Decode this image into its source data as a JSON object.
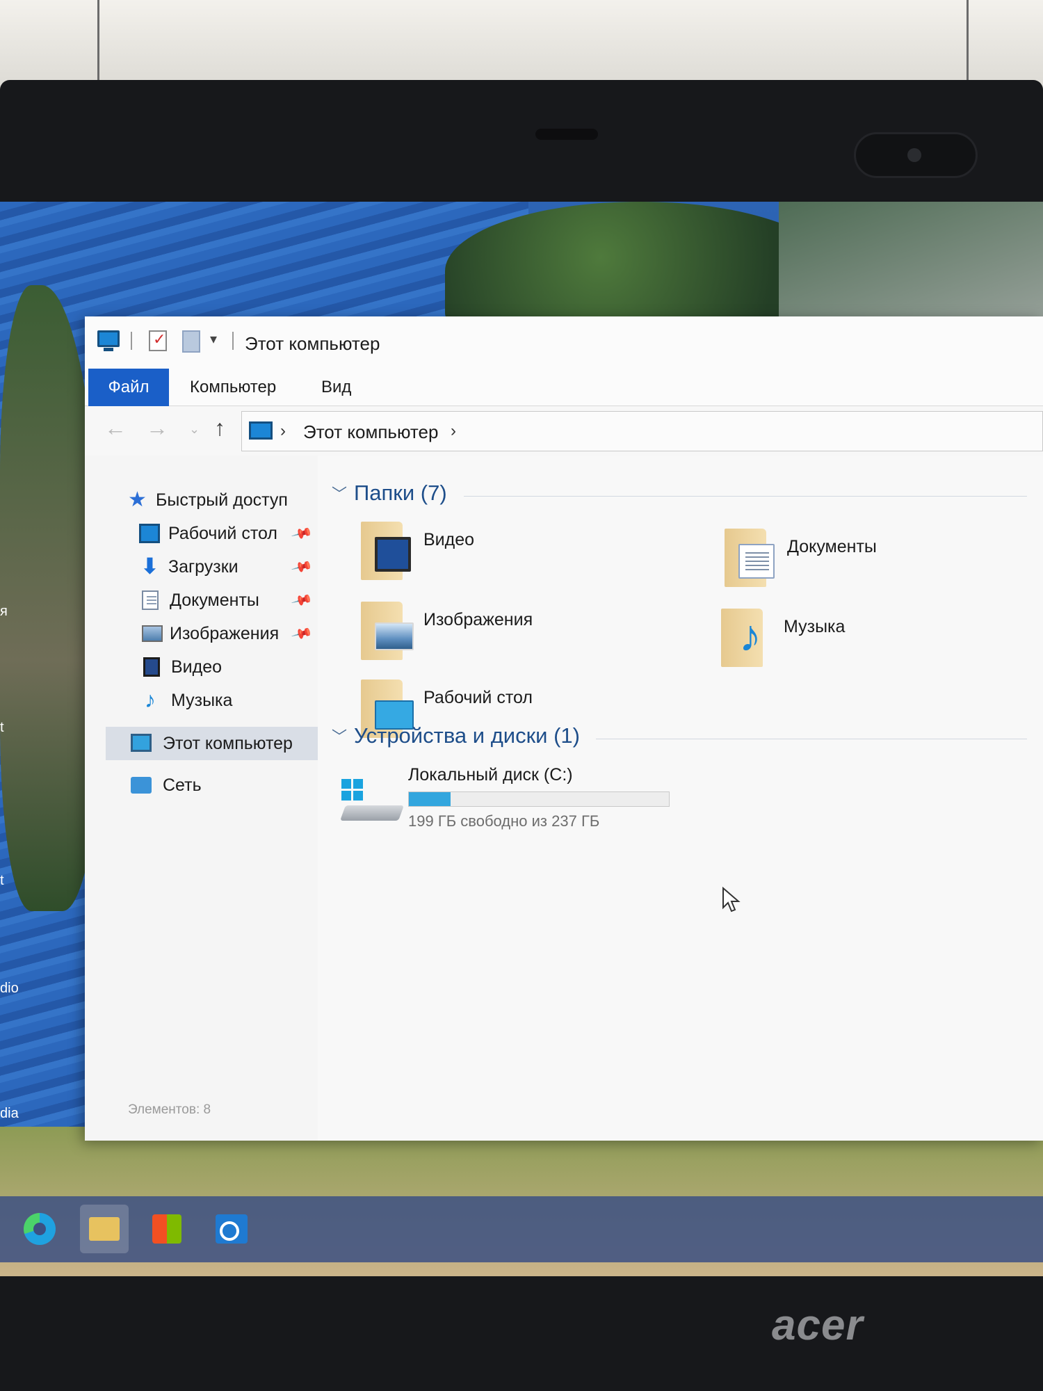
{
  "window": {
    "title": "Этот компьютер",
    "ribbon_tabs": [
      "Файл",
      "Компьютер",
      "Вид"
    ],
    "address": {
      "path": "Этот компьютер",
      "separator": "›"
    },
    "nav_buttons": {
      "back": "←",
      "forward": "→",
      "recent": "⌄",
      "up": "↑"
    }
  },
  "sidebar": {
    "quick_access": "Быстрый доступ",
    "items": [
      {
        "label": "Рабочий стол",
        "icon": "desktop-icon",
        "pinned": true
      },
      {
        "label": "Загрузки",
        "icon": "downloads-icon",
        "pinned": true
      },
      {
        "label": "Документы",
        "icon": "documents-icon",
        "pinned": true
      },
      {
        "label": "Изображения",
        "icon": "pictures-icon",
        "pinned": true
      },
      {
        "label": "Видео",
        "icon": "videos-icon",
        "pinned": false
      },
      {
        "label": "Музыка",
        "icon": "music-icon",
        "pinned": false
      }
    ],
    "this_pc": "Этот компьютер",
    "network": "Сеть"
  },
  "content": {
    "folders_header": "Папки (7)",
    "folders": [
      {
        "label": "Видео",
        "icon": "videos-folder-icon"
      },
      {
        "label": "Документы",
        "icon": "documents-folder-icon"
      },
      {
        "label": "Изображения",
        "icon": "pictures-folder-icon"
      },
      {
        "label": "Музыка",
        "icon": "music-folder-icon"
      },
      {
        "label": "Рабочий стол",
        "icon": "desktop-folder-icon"
      }
    ],
    "devices_header": "Устройства и диски (1)",
    "drive": {
      "label": "Локальный диск (C:)",
      "free_text": "199 ГБ свободно из 237 ГБ",
      "used_fraction": 0.16
    }
  },
  "status": {
    "items_count": "Элементов: 8"
  },
  "desktop_edge_labels": [
    "я",
    "t",
    "t",
    "dio",
    "dia"
  ],
  "brand": "acer",
  "colors": {
    "accent": "#1a5fc8",
    "header_blue": "#1e4e8a",
    "drive_fill": "#33a6de"
  }
}
